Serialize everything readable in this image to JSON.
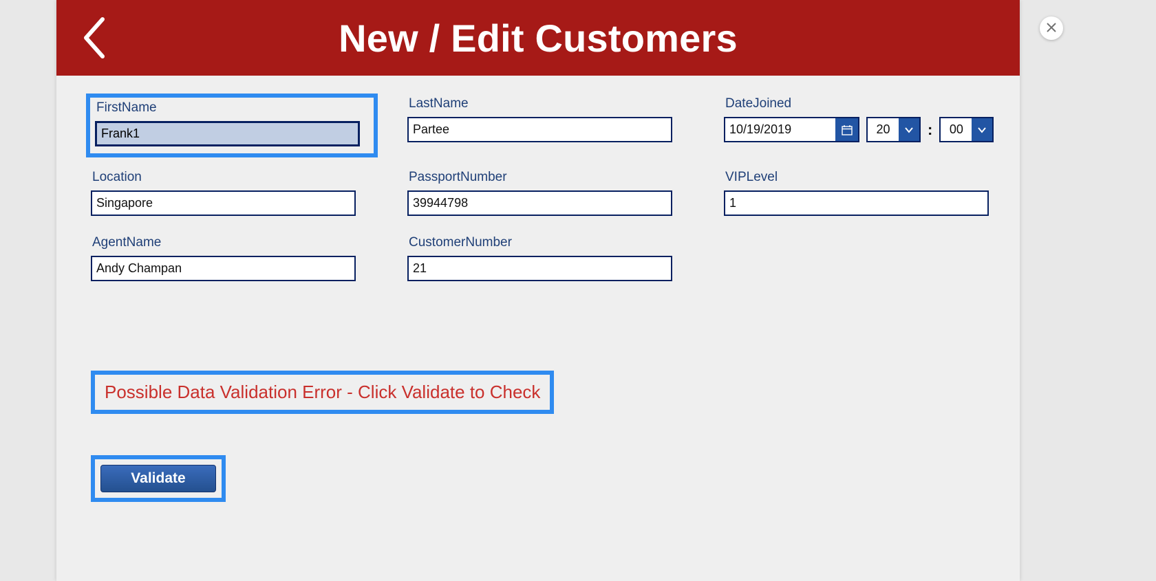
{
  "header": {
    "title": "New / Edit Customers"
  },
  "fields": {
    "firstName": {
      "label": "FirstName",
      "value": "Frank1"
    },
    "lastName": {
      "label": "LastName",
      "value": "Partee"
    },
    "dateJoined": {
      "label": "DateJoined",
      "date": "10/19/2019",
      "hour": "20",
      "minute": "00"
    },
    "location": {
      "label": "Location",
      "value": "Singapore"
    },
    "passportNumber": {
      "label": "PassportNumber",
      "value": "39944798"
    },
    "vipLevel": {
      "label": "VIPLevel",
      "value": "1"
    },
    "agentName": {
      "label": "AgentName",
      "value": "Andy Champan"
    },
    "customerNumber": {
      "label": "CustomerNumber",
      "value": "21"
    }
  },
  "validation": {
    "message": "Possible Data Validation Error - Click Validate to Check"
  },
  "buttons": {
    "validate": "Validate"
  },
  "time_separator": ":"
}
